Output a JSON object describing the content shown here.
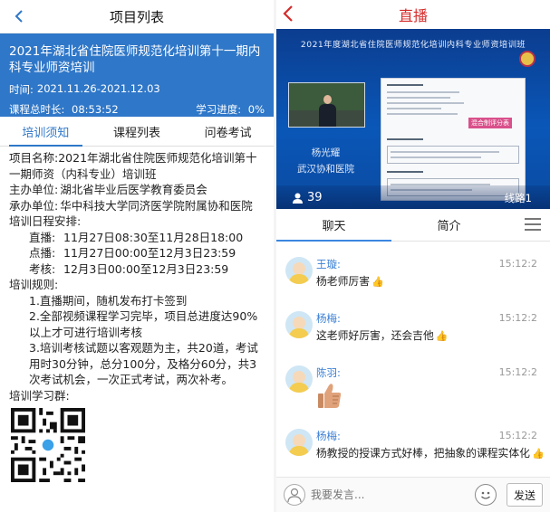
{
  "left": {
    "header_title": "项目列表",
    "project": {
      "name": "2021年湖北省住院医师规范化培训第十一期内科专业师资培训",
      "time_label": "时间:",
      "time_value": "2021.11.26-2021.12.03",
      "duration_label": "课程总时长:",
      "duration_value": "08:53:52",
      "progress_label": "学习进度:",
      "progress_value": "0%"
    },
    "tabs": [
      "培训须知",
      "课程列表",
      "问卷考试"
    ],
    "notice": {
      "project_name_key": "项目名称:",
      "project_name_val": "2021年湖北省住院医师规范化培训第十一期师资（内科专业）培训班",
      "organizer_key": "主办单位:",
      "organizer_val": "湖北省毕业后医学教育委员会",
      "host_key": "承办单位:",
      "host_val": "华中科技大学同济医学院附属协和医院",
      "schedule_title": "培训日程安排:",
      "schedule": [
        {
          "k": "直播:",
          "v": "11月27日08:30至11月28日18:00"
        },
        {
          "k": "点播:",
          "v": "11月27日00:00至12月3日23:59"
        },
        {
          "k": "考核:",
          "v": "12月3日00:00至12月3日23:59"
        }
      ],
      "rules_title": "培训规则:",
      "rules": [
        "1.直播期间，随机发布打卡签到",
        "2.全部视频课程学习完毕，项目总进度达90%以上才可进行培训考核",
        "3.培训考核试题以客观题为主，共20道，考试用时30分钟，总分100分，及格分60分，共3次考试机会，一次正式考试，两次补考。"
      ],
      "group_title": "培训学习群:"
    }
  },
  "right": {
    "header_title": "直播",
    "video": {
      "banner": "2021年度湖北省住院医师规范化培训内科专业师资培训班",
      "slide_tag": "混合制评分表",
      "speaker_name": "杨光耀",
      "speaker_org": "武汉协和医院",
      "viewers": "39",
      "line": "线路1"
    },
    "tabs": [
      "聊天",
      "简介"
    ],
    "messages": [
      {
        "name": "王璇:",
        "time": "15:12:2",
        "text": "杨老师厉害",
        "thumb": true
      },
      {
        "name": "杨梅:",
        "time": "15:12:2",
        "text": "这老师好厉害，还会吉他",
        "thumb": true
      },
      {
        "name": "陈羽:",
        "time": "15:12:2",
        "text": "",
        "thumb": false
      },
      {
        "name": "杨梅:",
        "time": "15:12:2",
        "text": "杨教授的授课方式好棒，把抽象的课程实体化",
        "thumb": true
      }
    ],
    "input": {
      "placeholder": "我要发言...",
      "send_label": "发送"
    },
    "colors": {
      "accent_blue": "#2f77c8",
      "title_red": "#d52b2b",
      "name_blue": "#3a7fd5"
    }
  }
}
